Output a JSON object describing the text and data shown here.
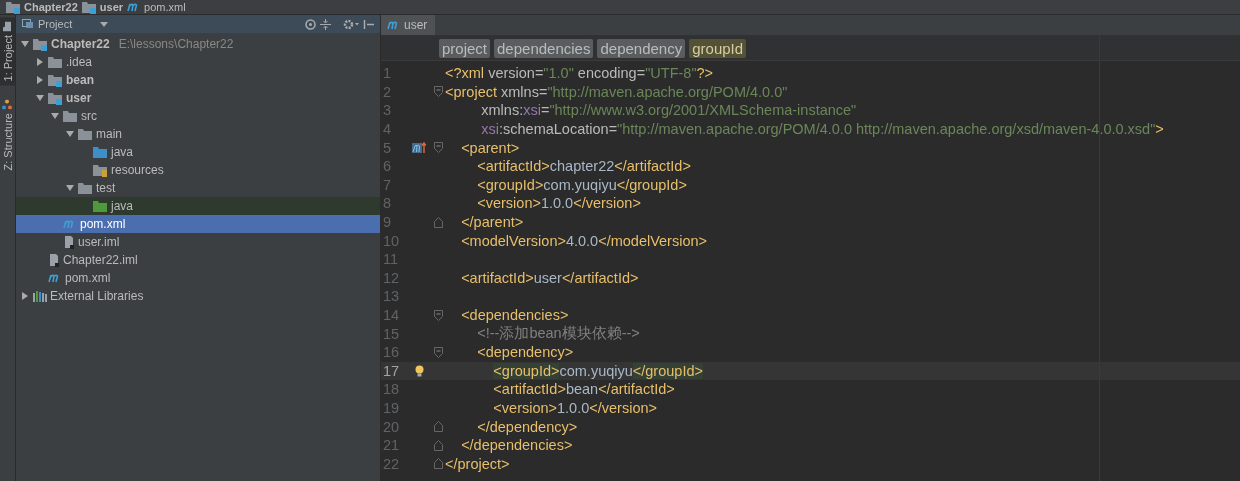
{
  "breadcrumbs": [
    {
      "label": "Chapter22",
      "kind": "module"
    },
    {
      "label": "user",
      "kind": "module"
    },
    {
      "label": "pom.xml",
      "kind": "maven"
    }
  ],
  "side_strip": [
    {
      "label": "1: Project",
      "selected": true,
      "kind": "project"
    },
    {
      "label": "Z: Structure",
      "selected": false,
      "kind": "structure"
    }
  ],
  "project_panel": {
    "title": "Project",
    "tree": [
      {
        "label": "Chapter22",
        "note": "E:\\lessons\\Chapter22",
        "kind": "module",
        "bold": true,
        "expanded": true,
        "selected": false,
        "children": [
          {
            "label": ".idea",
            "kind": "folder",
            "bold": false,
            "expanded": false,
            "selected": false
          },
          {
            "label": "bean",
            "kind": "module",
            "bold": true,
            "expanded": false,
            "selected": false
          },
          {
            "label": "user",
            "kind": "module",
            "bold": true,
            "expanded": true,
            "selected": false,
            "children": [
              {
                "label": "src",
                "kind": "folder",
                "bold": false,
                "expanded": true,
                "selected": false,
                "children": [
                  {
                    "label": "main",
                    "kind": "folder",
                    "bold": false,
                    "expanded": true,
                    "selected": false,
                    "children": [
                      {
                        "label": "java",
                        "kind": "source",
                        "bold": false,
                        "selected": false
                      },
                      {
                        "label": "resources",
                        "kind": "resources",
                        "bold": false,
                        "selected": false
                      }
                    ]
                  },
                  {
                    "label": "test",
                    "kind": "folder",
                    "bold": false,
                    "expanded": true,
                    "selected": false,
                    "children": [
                      {
                        "label": "java",
                        "kind": "test-source",
                        "bold": false,
                        "selected": false
                      }
                    ]
                  }
                ]
              },
              {
                "label": "pom.xml",
                "kind": "maven",
                "bold": false,
                "selected": true
              },
              {
                "label": "user.iml",
                "kind": "iml",
                "bold": false,
                "selected": false
              }
            ]
          },
          {
            "label": "Chapter22.iml",
            "kind": "iml",
            "bold": false,
            "selected": false
          },
          {
            "label": "pom.xml",
            "kind": "maven",
            "bold": false,
            "selected": false
          }
        ]
      },
      {
        "label": "External Libraries",
        "kind": "libraries",
        "bold": false,
        "expanded": false,
        "selected": false
      }
    ]
  },
  "editor": {
    "tabs": [
      {
        "label": "user",
        "selected": true
      }
    ],
    "path": [
      {
        "label": "project",
        "selected": false
      },
      {
        "label": "dependencies",
        "selected": false
      },
      {
        "label": "dependency",
        "selected": false
      },
      {
        "label": "groupId",
        "selected": true
      }
    ],
    "lines": [
      {
        "number": "1",
        "current": false,
        "tokens": [
          {
            "kind": "tag",
            "text": "<?xml "
          },
          {
            "kind": "attr",
            "text": "version"
          },
          {
            "kind": "eq",
            "text": "="
          },
          {
            "kind": "value",
            "text": "\"1.0\""
          },
          {
            "kind": "attr",
            "text": " encoding"
          },
          {
            "kind": "eq",
            "text": "="
          },
          {
            "kind": "value",
            "text": "\"UTF-8\""
          },
          {
            "kind": "tag",
            "text": "?>"
          }
        ]
      },
      {
        "number": "2",
        "fold_marker": {
          "kind": "start"
        },
        "current": false,
        "tokens": [
          {
            "kind": "tag",
            "text": "<project "
          },
          {
            "kind": "attr",
            "text": "xmlns"
          },
          {
            "kind": "eq",
            "text": "="
          },
          {
            "kind": "value",
            "text": "\"http://maven.apache.org/POM/4.0.0\""
          }
        ]
      },
      {
        "number": "3",
        "current": false,
        "tokens": [
          {
            "kind": "attr",
            "text": "         xmlns:"
          },
          {
            "kind": "ns",
            "text": "xsi"
          },
          {
            "kind": "eq",
            "text": "="
          },
          {
            "kind": "value",
            "text": "\"http://www.w3.org/2001/XMLSchema-instance\""
          }
        ]
      },
      {
        "number": "4",
        "current": false,
        "tokens": [
          {
            "kind": "ns",
            "text": "         xsi"
          },
          {
            "kind": "attr",
            "text": ":schemaLocation"
          },
          {
            "kind": "eq",
            "text": "="
          },
          {
            "kind": "value",
            "text": "\"http://maven.apache.org/POM/4.0.0 http://maven.apache.org/xsd/maven-4.0.0.xsd\""
          },
          {
            "kind": "tag",
            "text": ">"
          }
        ]
      },
      {
        "number": "5",
        "gutter_icon": {
          "kind": "override"
        },
        "fold_marker": {
          "kind": "start"
        },
        "current": false,
        "tokens": [
          {
            "kind": "tag",
            "text": "    <parent>"
          }
        ]
      },
      {
        "number": "6",
        "current": false,
        "tokens": [
          {
            "kind": "tag",
            "text": "        <artifactId>"
          },
          {
            "kind": "text",
            "text": "chapter22"
          },
          {
            "kind": "tag",
            "text": "</artifactId>"
          }
        ]
      },
      {
        "number": "7",
        "current": false,
        "tokens": [
          {
            "kind": "tag",
            "text": "        <groupId>"
          },
          {
            "kind": "text",
            "text": "com.yuqiyu"
          },
          {
            "kind": "tag",
            "text": "</groupId>"
          }
        ]
      },
      {
        "number": "8",
        "current": false,
        "tokens": [
          {
            "kind": "tag",
            "text": "        <version>"
          },
          {
            "kind": "text",
            "text": "1.0.0"
          },
          {
            "kind": "tag",
            "text": "</version>"
          }
        ]
      },
      {
        "number": "9",
        "fold_marker": {
          "kind": "end"
        },
        "current": false,
        "tokens": [
          {
            "kind": "tag",
            "text": "    </parent>"
          }
        ]
      },
      {
        "number": "10",
        "current": false,
        "tokens": [
          {
            "kind": "tag",
            "text": "    <modelVersion>"
          },
          {
            "kind": "text",
            "text": "4.0.0"
          },
          {
            "kind": "tag",
            "text": "</modelVersion>"
          }
        ]
      },
      {
        "number": "11",
        "current": false
      },
      {
        "number": "12",
        "current": false,
        "tokens": [
          {
            "kind": "tag",
            "text": "    <artifactId>"
          },
          {
            "kind": "text",
            "text": "user"
          },
          {
            "kind": "tag",
            "text": "</artifactId>"
          }
        ]
      },
      {
        "number": "13",
        "current": false
      },
      {
        "number": "14",
        "fold_marker": {
          "kind": "start"
        },
        "current": false,
        "tokens": [
          {
            "kind": "tag",
            "text": "    <dependencies>"
          }
        ]
      },
      {
        "number": "15",
        "current": false,
        "tokens": [
          {
            "kind": "comment",
            "text": "        <!--添加bean模块依赖-->"
          }
        ]
      },
      {
        "number": "16",
        "fold_marker": {
          "kind": "start"
        },
        "current": false,
        "tokens": [
          {
            "kind": "tag",
            "text": "        <dependency>"
          }
        ]
      },
      {
        "number": "17",
        "gutter_icon": {
          "kind": "bulb"
        },
        "current": true,
        "tokens": [
          {
            "kind": "match",
            "text": "            <groupId>"
          },
          {
            "kind": "text",
            "text": "com.yuqiyu"
          },
          {
            "kind": "match",
            "text": "</groupId>"
          }
        ]
      },
      {
        "number": "18",
        "current": false,
        "tokens": [
          {
            "kind": "tag",
            "text": "            <artifactId>"
          },
          {
            "kind": "text",
            "text": "bean"
          },
          {
            "kind": "tag",
            "text": "</artifactId>"
          }
        ]
      },
      {
        "number": "19",
        "current": false,
        "tokens": [
          {
            "kind": "tag",
            "text": "            <version>"
          },
          {
            "kind": "text",
            "text": "1.0.0"
          },
          {
            "kind": "tag",
            "text": "</version>"
          }
        ]
      },
      {
        "number": "20",
        "fold_marker": {
          "kind": "end"
        },
        "current": false,
        "tokens": [
          {
            "kind": "tag",
            "text": "        </dependency>"
          }
        ]
      },
      {
        "number": "21",
        "fold_marker": {
          "kind": "end"
        },
        "current": false,
        "tokens": [
          {
            "kind": "tag",
            "text": "    </dependencies>"
          }
        ]
      },
      {
        "number": "22",
        "fold_marker": {
          "kind": "end"
        },
        "current": false,
        "tokens": [
          {
            "kind": "tag",
            "text": "</project>"
          }
        ]
      }
    ]
  }
}
